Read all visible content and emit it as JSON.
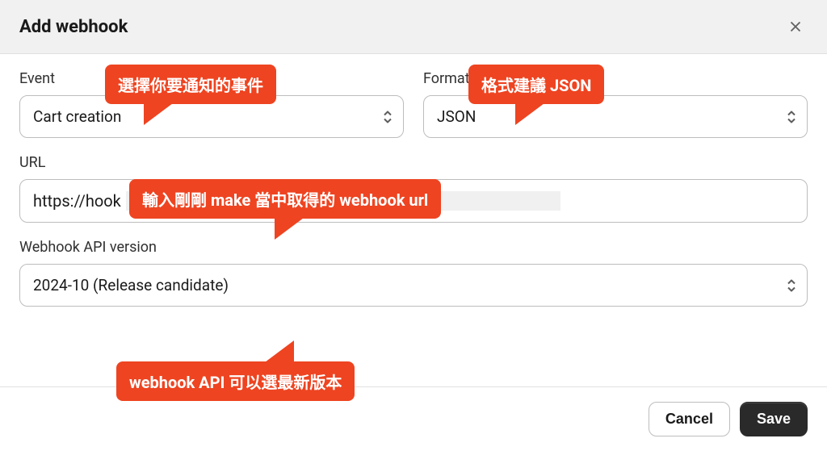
{
  "header": {
    "title": "Add webhook"
  },
  "fields": {
    "event": {
      "label": "Event",
      "value": "Cart creation"
    },
    "format": {
      "label": "Format",
      "value": "JSON"
    },
    "url": {
      "label": "URL",
      "value": "https://hook"
    },
    "api_version": {
      "label": "Webhook API version",
      "value": "2024-10 (Release candidate)"
    }
  },
  "callouts": {
    "event": "選擇你要通知的事件",
    "format": "格式建議 JSON",
    "url": "輸入剛剛 make 當中取得的 webhook url",
    "api": "webhook API 可以選最新版本"
  },
  "footer": {
    "cancel": "Cancel",
    "save": "Save"
  }
}
